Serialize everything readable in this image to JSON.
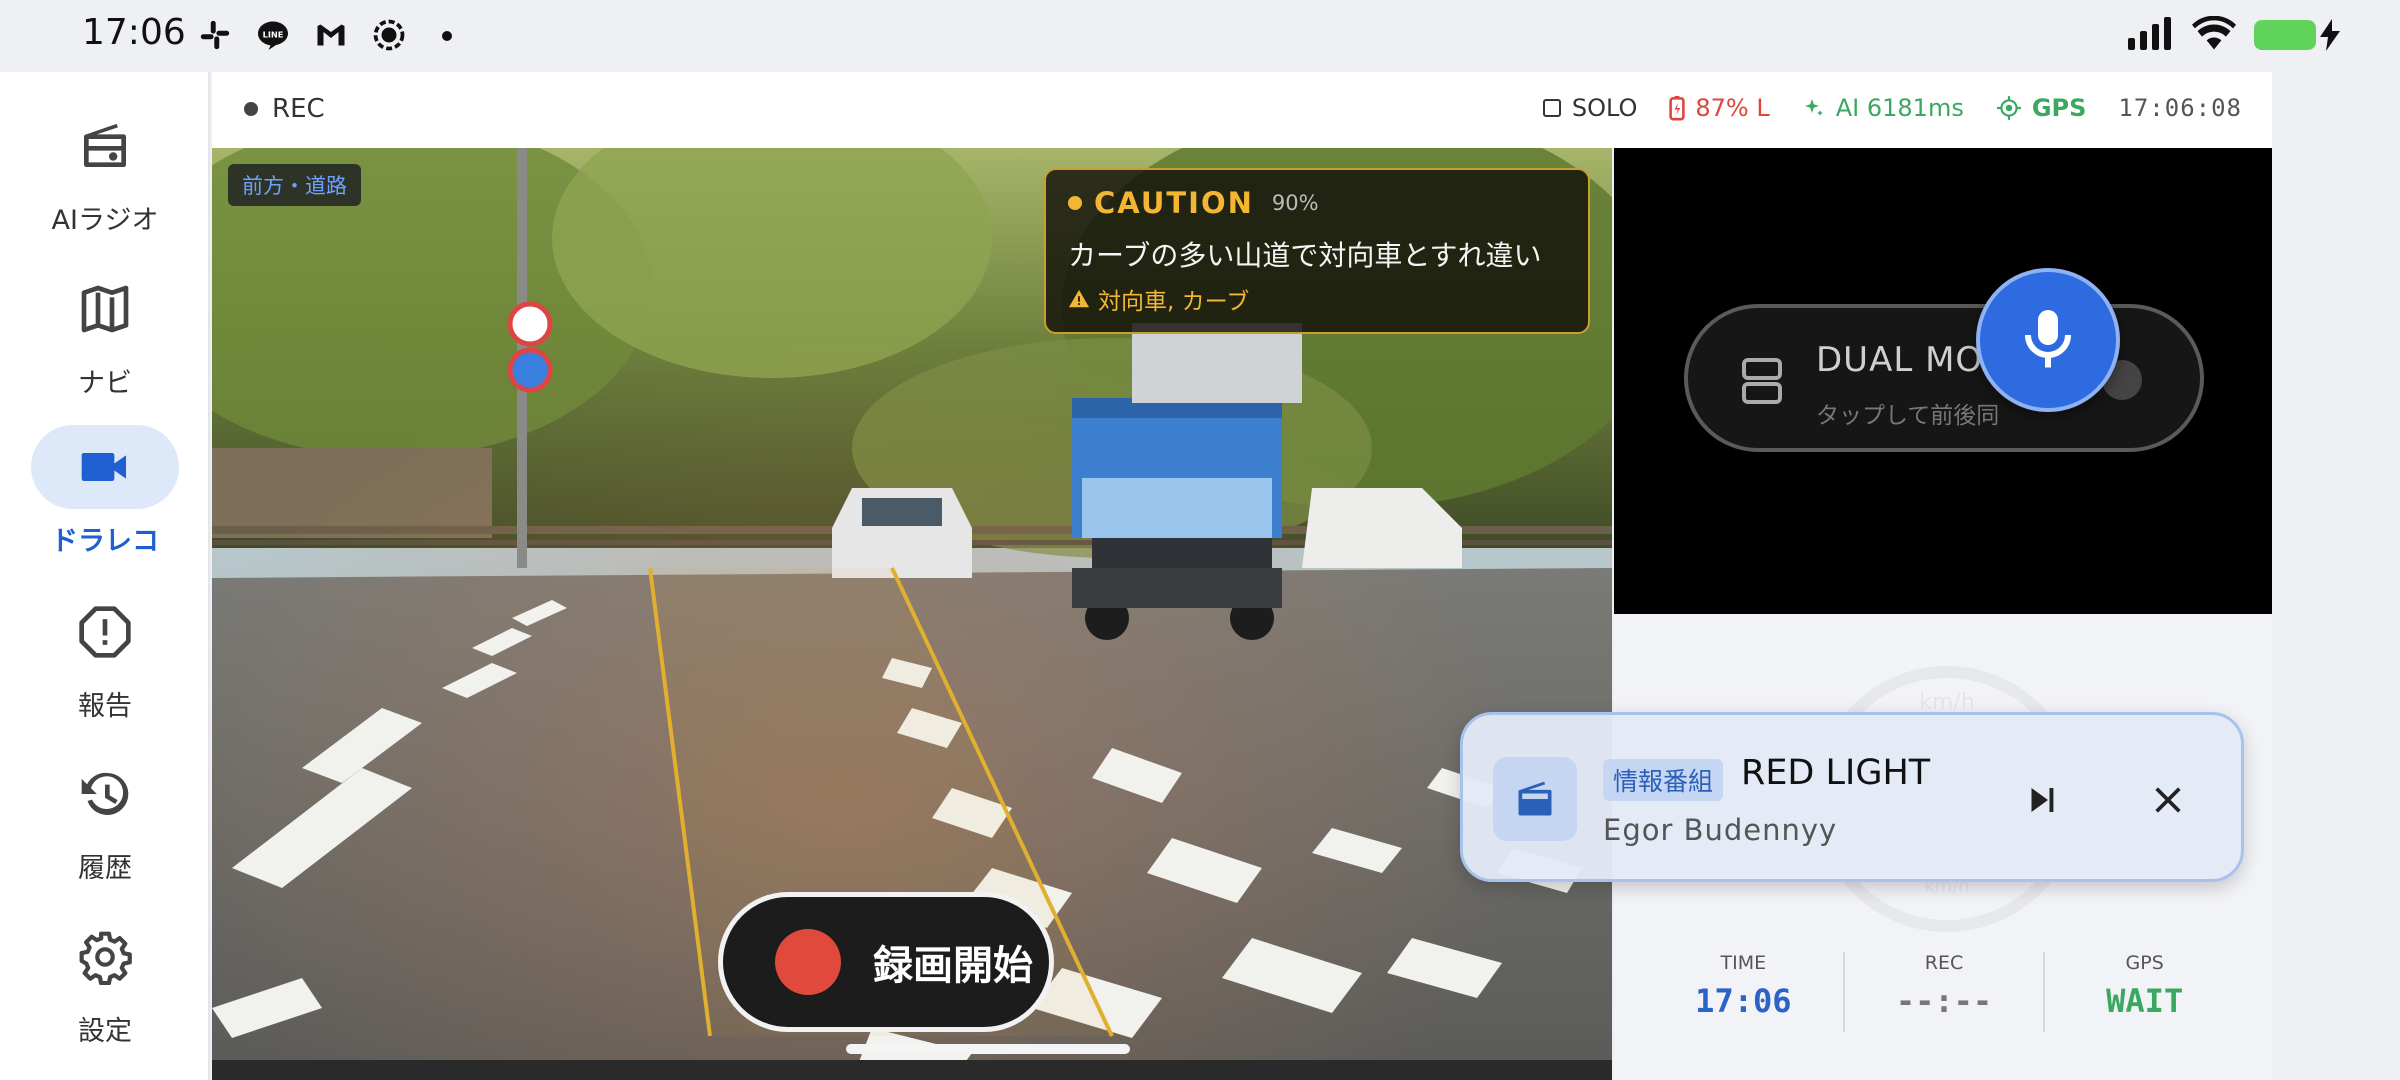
{
  "status_bar": {
    "time": "17:06",
    "notif_icons": [
      "slack-icon",
      "line-icon",
      "gmail-icon",
      "screen-record-icon"
    ],
    "right_icons": [
      "signal-icon",
      "wifi-icon",
      "battery-charging-icon"
    ]
  },
  "nav": {
    "items": [
      {
        "label": "AIラジオ",
        "icon": "radio-icon",
        "active": false
      },
      {
        "label": "ナビ",
        "icon": "map-icon",
        "active": false
      },
      {
        "label": "ドラレコ",
        "icon": "videocam-icon",
        "active": true
      },
      {
        "label": "報告",
        "icon": "alert-icon",
        "active": false
      },
      {
        "label": "履歴",
        "icon": "history-icon",
        "active": false
      },
      {
        "label": "設定",
        "icon": "gear-icon",
        "active": false
      }
    ]
  },
  "topbar": {
    "rec_label": "REC",
    "solo_label": "SOLO",
    "battery_label": "87% L",
    "ai_label": "AI 6181ms",
    "gps_label": "GPS",
    "clock": "17:06:08"
  },
  "camera": {
    "tag": "前方・道路",
    "caution": {
      "title": "CAUTION",
      "confidence": "90%",
      "message": "カーブの多い山道で対向車とすれ違い",
      "hazards": "対向車, カーブ"
    },
    "record_button": "録画開始"
  },
  "dual_mode": {
    "title": "DUAL MO",
    "subtitle": "タップして前後同"
  },
  "speed": {
    "unit": "km/h",
    "value": "0",
    "sub": "km/h"
  },
  "stats": [
    {
      "label": "TIME",
      "value": "17:06"
    },
    {
      "label": "REC",
      "value": "--:--"
    },
    {
      "label": "GPS",
      "value": "WAIT"
    }
  ],
  "player": {
    "genre": "情報番組",
    "title": "RED LIGHT",
    "artist": "Egor Budennyy"
  },
  "colors": {
    "accent": "#1f5fd1",
    "caution": "#f2b633",
    "record": "#e04a3c",
    "ok": "#3aa860",
    "warn": "#e0443a"
  }
}
